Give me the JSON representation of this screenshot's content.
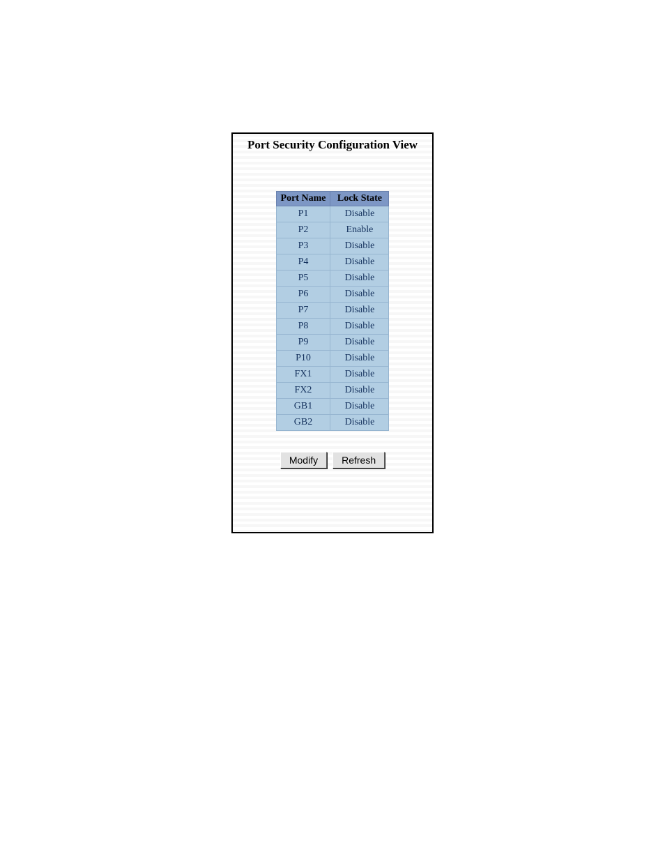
{
  "title": "Port Security Configuration View",
  "table": {
    "headers": {
      "port_name": "Port Name",
      "lock_state": "Lock State"
    },
    "rows": [
      {
        "port": "P1",
        "state": "Disable"
      },
      {
        "port": "P2",
        "state": "Enable"
      },
      {
        "port": "P3",
        "state": "Disable"
      },
      {
        "port": "P4",
        "state": "Disable"
      },
      {
        "port": "P5",
        "state": "Disable"
      },
      {
        "port": "P6",
        "state": "Disable"
      },
      {
        "port": "P7",
        "state": "Disable"
      },
      {
        "port": "P8",
        "state": "Disable"
      },
      {
        "port": "P9",
        "state": "Disable"
      },
      {
        "port": "P10",
        "state": "Disable"
      },
      {
        "port": "FX1",
        "state": "Disable"
      },
      {
        "port": "FX2",
        "state": "Disable"
      },
      {
        "port": "GB1",
        "state": "Disable"
      },
      {
        "port": "GB2",
        "state": "Disable"
      }
    ]
  },
  "buttons": {
    "modify": "Modify",
    "refresh": "Refresh"
  }
}
